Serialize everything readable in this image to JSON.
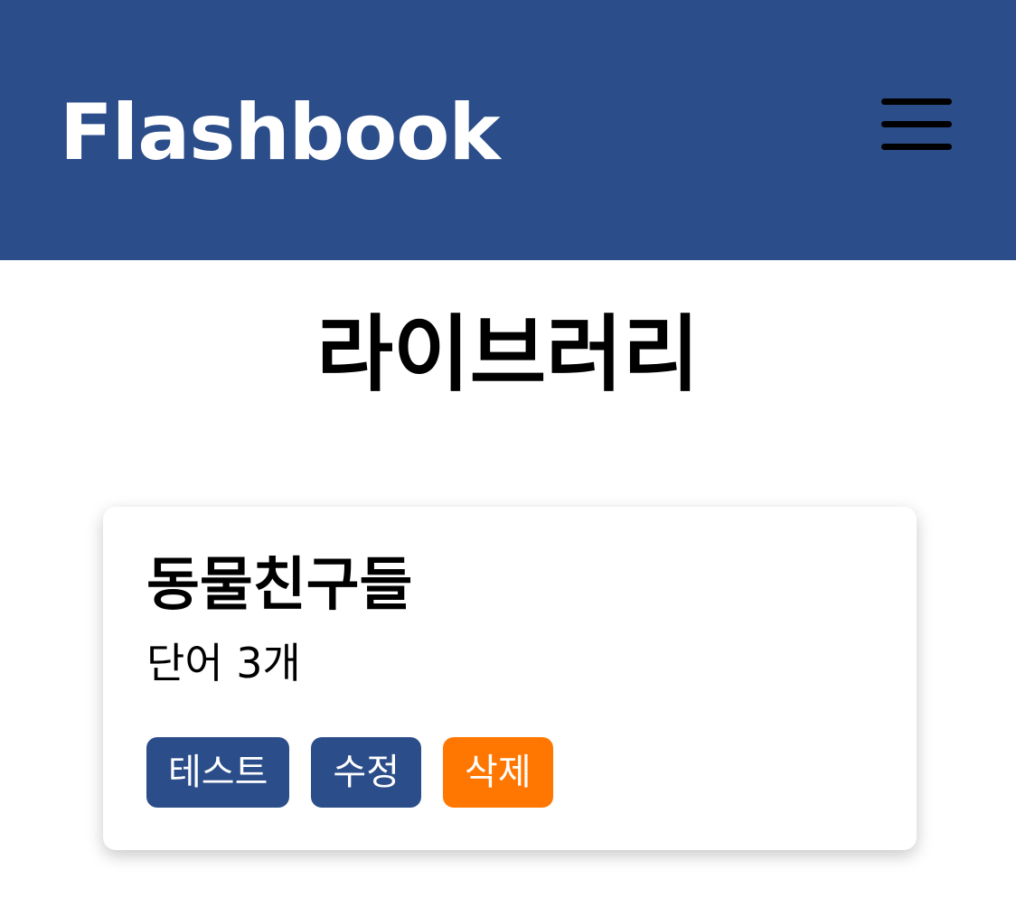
{
  "header": {
    "logo_text": "Flashbook",
    "menu_icon": "hamburger-menu-icon",
    "background_color": "#2b4d89"
  },
  "page": {
    "title": "라이브러리"
  },
  "library": {
    "cards": [
      {
        "title": "동물친구들",
        "count_text": "단어 3개",
        "actions": {
          "test_label": "테스트",
          "edit_label": "수정",
          "delete_label": "삭제"
        }
      }
    ]
  },
  "colors": {
    "primary": "#2b4d89",
    "danger": "#ff7700"
  }
}
